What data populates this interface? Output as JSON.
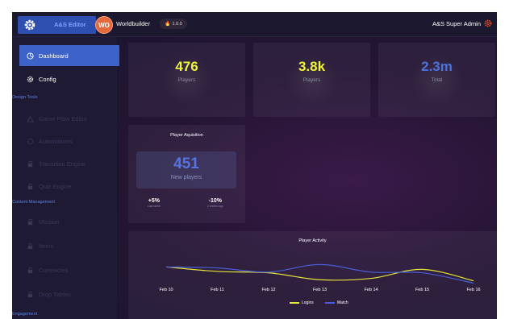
{
  "header": {
    "logo_text": "A&S Editor",
    "avatar_initials": "WO",
    "app_name": "Worldbuilder",
    "version": "1.0.0",
    "admin_label": "A&S Super Admin"
  },
  "sidebar": {
    "dashboard": "Dashboard",
    "config": "Config",
    "design_tools_label": "Design Tools",
    "design_tools": [
      "Game Flow Editor",
      "Automations",
      "Transition Engine",
      "Quiz Engine"
    ],
    "content_label": "Content Management",
    "content": [
      "Mission",
      "Items",
      "Currencies",
      "Drop Tables"
    ],
    "engagement_label": "Engagement"
  },
  "stats": [
    {
      "value": "476",
      "label": "Players",
      "color": "#eff53a"
    },
    {
      "value": "3.8k",
      "label": "Players",
      "color": "#eff53a"
    },
    {
      "value": "2.3m",
      "label": "Total",
      "color": "#4c72dd"
    }
  ],
  "acquisition": {
    "title": "Player Aquisition",
    "value": "451",
    "label": "New players",
    "deltas": [
      {
        "value": "+5%",
        "sub": "Last week"
      },
      {
        "value": "-10%",
        "sub": "2 weeks ago"
      }
    ]
  },
  "chart_data": {
    "type": "line",
    "title": "Player Activity",
    "categories": [
      "Feb 10",
      "Feb 11",
      "Feb 12",
      "Feb 13",
      "Feb 14",
      "Feb 15",
      "Feb 16"
    ],
    "series": [
      {
        "name": "Logins",
        "color": "#e4e43c",
        "values": [
          55,
          42,
          38,
          18,
          22,
          48,
          15
        ]
      },
      {
        "name": "Match",
        "color": "#4a5dd6",
        "values": [
          55,
          52,
          40,
          62,
          40,
          38,
          8
        ]
      }
    ],
    "ylim": [
      0,
      100
    ]
  }
}
